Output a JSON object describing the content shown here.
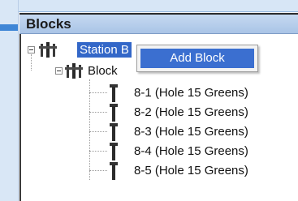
{
  "panel": {
    "title": "Blocks"
  },
  "tree": {
    "root_label": "Station B",
    "block_label": "Block",
    "stations": [
      {
        "label": "8-1  (Hole 15 Greens)"
      },
      {
        "label": "8-2  (Hole 15 Greens)"
      },
      {
        "label": "8-3  (Hole 15 Greens)"
      },
      {
        "label": "8-4  (Hole 15 Greens)"
      },
      {
        "label": "8-5  (Hole 15 Greens)"
      }
    ]
  },
  "context_menu": {
    "items": [
      {
        "label": "Add Block"
      }
    ]
  },
  "colors": {
    "selection": "#3367c8",
    "menu_highlight": "#3b6fd0",
    "titlebar": "#b7cfee"
  },
  "icons": {
    "root": "sprinkler-group-icon",
    "block": "sprinkler-group-icon",
    "station": "sprinkler-head-icon",
    "expander": "collapse-minus-icon"
  }
}
